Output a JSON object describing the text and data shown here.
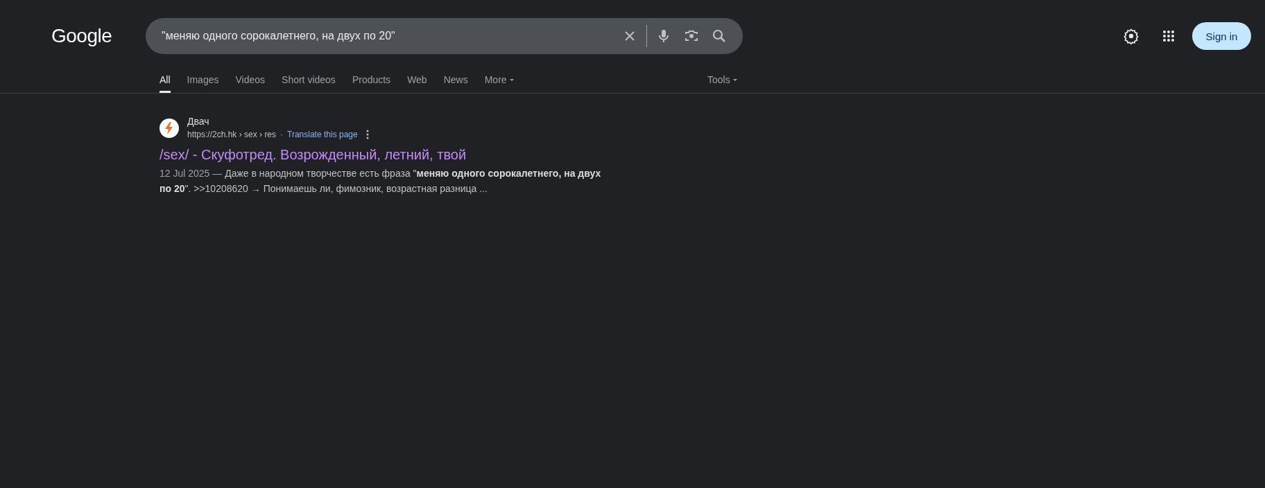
{
  "logo": "Google",
  "search": {
    "value": "\"меняю одного сорокалетнего, на двух по 20\""
  },
  "sign_in": "Sign in",
  "tabs": [
    {
      "label": "All",
      "selected": true,
      "kind": "plain"
    },
    {
      "label": "Images",
      "selected": false,
      "kind": "plain"
    },
    {
      "label": "Videos",
      "selected": false,
      "kind": "plain"
    },
    {
      "label": "Short videos",
      "selected": false,
      "kind": "plain"
    },
    {
      "label": "Products",
      "selected": false,
      "kind": "plain"
    },
    {
      "label": "Web",
      "selected": false,
      "kind": "plain"
    },
    {
      "label": "News",
      "selected": false,
      "kind": "plain"
    },
    {
      "label": "More",
      "selected": false,
      "kind": "menu"
    }
  ],
  "tools": "Tools",
  "results": [
    {
      "site": "Двач",
      "url": "https://2ch.hk › sex › res",
      "separator": "·",
      "translate": "Translate this page",
      "title": "/sex/ - Скуфотред. Возрожденный, летний, твой",
      "date": "12 Jul 2025 —",
      "snippet": "Даже в народном творчестве есть фраза \"**меняю одного сорокалетнего, на двух по 20**\". >>10208620 → Понимаешь ли, фимозник, возрастная разница ..."
    }
  ]
}
